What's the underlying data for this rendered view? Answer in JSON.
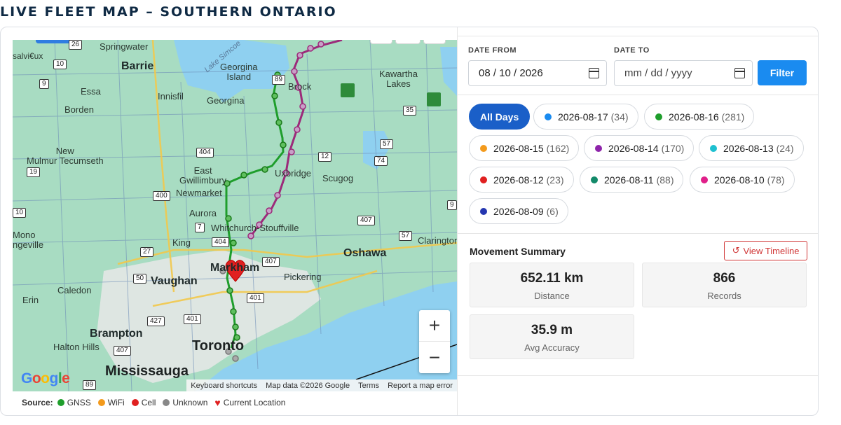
{
  "page_title": "LIVE FLEET MAP – SOUTHERN ONTARIO",
  "map": {
    "places": [
      {
        "id": "springwater",
        "text": "Springwater"
      },
      {
        "id": "salvieux",
        "text": "salvi€ux"
      },
      {
        "id": "barrie",
        "text": "Barrie"
      },
      {
        "id": "essa",
        "text": "Essa"
      },
      {
        "id": "borden",
        "text": "Borden"
      },
      {
        "id": "innisfil",
        "text": "Innisfil"
      },
      {
        "id": "georgina-island",
        "text": "Georgina\nIsland"
      },
      {
        "id": "georgina",
        "text": "Georgina"
      },
      {
        "id": "brock",
        "text": "Brock"
      },
      {
        "id": "kawartha",
        "text": "Kawartha\nLakes"
      },
      {
        "id": "new-tecumseth",
        "text": "New\nMulmur Tecumseth"
      },
      {
        "id": "east-gwillimbury",
        "text": "East\nGwillimbury"
      },
      {
        "id": "newmarket",
        "text": "Newmarket"
      },
      {
        "id": "uxbridge",
        "text": "Uxbridge"
      },
      {
        "id": "scugog",
        "text": "Scugog"
      },
      {
        "id": "aurora",
        "text": "Aurora"
      },
      {
        "id": "whitchurch",
        "text": "Whitchurch-Stouffville"
      },
      {
        "id": "mono",
        "text": "Mono\nngeville"
      },
      {
        "id": "king",
        "text": "King"
      },
      {
        "id": "markham",
        "text": "Markham"
      },
      {
        "id": "oshawa",
        "text": "Oshawa"
      },
      {
        "id": "clarington",
        "text": "Clarington"
      },
      {
        "id": "caledon",
        "text": "Caledon"
      },
      {
        "id": "vaughan",
        "text": "Vaughan"
      },
      {
        "id": "pickering",
        "text": "Pickering"
      },
      {
        "id": "erin",
        "text": "Erin"
      },
      {
        "id": "brampton",
        "text": "Brampton"
      },
      {
        "id": "halton-hills",
        "text": "Halton Hills"
      },
      {
        "id": "toronto",
        "text": "Toronto"
      },
      {
        "id": "mississauga",
        "text": "Mississauga"
      },
      {
        "id": "lake-simcoe",
        "text": "Lake Simcoe"
      }
    ],
    "shields": [
      "26",
      "10",
      "9",
      "89",
      "35",
      "57",
      "74",
      "12",
      "404",
      "19",
      "400",
      "10",
      "7",
      "404",
      "407",
      "57",
      "9",
      "27",
      "407",
      "50",
      "401",
      "427",
      "401",
      "407",
      "89"
    ],
    "zoom_in": "+",
    "zoom_out": "−",
    "google_logo": "Google",
    "attribution": {
      "shortcuts": "Keyboard shortcuts",
      "data": "Map data ©2026 Google",
      "terms": "Terms",
      "report": "Report a map error"
    }
  },
  "legend": {
    "label": "Source:",
    "items": [
      {
        "label": "GNSS",
        "color": "#1f9e2c"
      },
      {
        "label": "WiFi",
        "color": "#f39a1c"
      },
      {
        "label": "Cell",
        "color": "#e02020"
      },
      {
        "label": "Unknown",
        "color": "#888888"
      },
      {
        "label": "Current Location",
        "color": "#e02020",
        "icon": "heart-icon"
      }
    ]
  },
  "filters": {
    "date_from_label": "DATE FROM",
    "date_from_value": "08 / 10 / 2026",
    "date_to_label": "DATE TO",
    "date_to_placeholder": "mm / dd / yyyy",
    "filter_button": "Filter"
  },
  "day_chips": [
    {
      "label": "All Days",
      "count": "",
      "color": "",
      "active": true
    },
    {
      "label": "2026-08-17",
      "count": "(34)",
      "color": "#1a8bf0"
    },
    {
      "label": "2026-08-16",
      "count": "(281)",
      "color": "#1f9e2c"
    },
    {
      "label": "2026-08-15",
      "count": "(162)",
      "color": "#f39a1c"
    },
    {
      "label": "2026-08-14",
      "count": "(170)",
      "color": "#8e24aa"
    },
    {
      "label": "2026-08-13",
      "count": "(24)",
      "color": "#1ec0d0"
    },
    {
      "label": "2026-08-12",
      "count": "(23)",
      "color": "#e02020"
    },
    {
      "label": "2026-08-11",
      "count": "(88)",
      "color": "#138a6a"
    },
    {
      "label": "2026-08-10",
      "count": "(78)",
      "color": "#e0208a"
    },
    {
      "label": "2026-08-09",
      "count": "(6)",
      "color": "#2436b0"
    }
  ],
  "summary": {
    "title": "Movement Summary",
    "timeline_button": "View Timeline",
    "distance_value": "652.11 km",
    "distance_label": "Distance",
    "records_value": "866",
    "records_label": "Records",
    "accuracy_value": "35.9 m",
    "accuracy_label": "Avg Accuracy"
  },
  "colors": {
    "accent": "#1a8bf0",
    "active_chip": "#1a5fc8",
    "route_green": "#1f9e2c",
    "route_purple": "#9c2a7a",
    "danger": "#d03535"
  }
}
